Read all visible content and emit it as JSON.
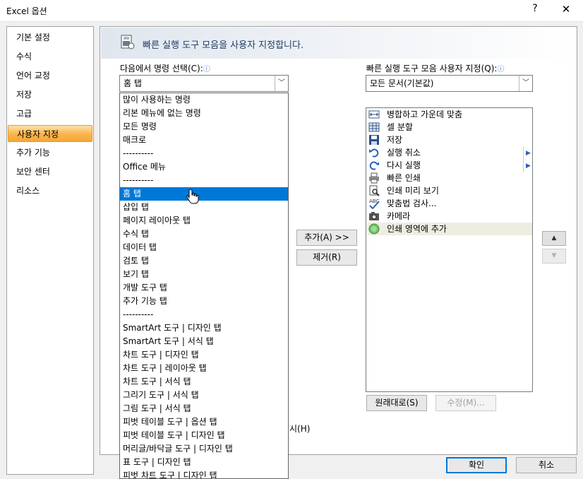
{
  "window": {
    "title": "Excel 옵션",
    "help": "?",
    "close": "✕"
  },
  "nav": {
    "items": [
      {
        "label": "기본 설정"
      },
      {
        "label": "수식"
      },
      {
        "label": "언어 교정"
      },
      {
        "label": "저장"
      },
      {
        "label": "고급"
      },
      {
        "label": "사용자 지정",
        "selected": true
      },
      {
        "label": "추가 기능"
      },
      {
        "label": "보안 센터"
      },
      {
        "label": "리소스"
      }
    ]
  },
  "header": {
    "text": "빠른 실행 도구 모음을 사용자 지정합니다."
  },
  "left": {
    "label": "다음에서 명령 선택(C):",
    "info": "ⓘ",
    "combo_value": "홈 탭",
    "dropdown_items": [
      "많이 사용하는 명령",
      "리본 메뉴에 없는 명령",
      "모든 명령",
      "매크로",
      "----------",
      "Office 메뉴",
      "----------",
      "홈 탭",
      "삽입 탭",
      "페이지 레이아웃 탭",
      "수식 탭",
      "데이터 탭",
      "검토 탭",
      "보기 탭",
      "개발 도구 탭",
      "추가 기능 탭",
      "----------",
      "SmartArt 도구 | 디자인 탭",
      "SmartArt 도구 | 서식 탭",
      "차트 도구 | 디자인 탭",
      "차트 도구 | 레이아웃 탭",
      "차트 도구 | 서식 탭",
      "그리기 도구 | 서식 탭",
      "그림 도구 | 서식 탭",
      "피벗 테이블 도구 | 옵션 탭",
      "피벗 테이블 도구 | 디자인 탭",
      "머리글/바닥글 도구 | 디자인 탭",
      "표 도구 | 디자인 탭",
      "피벗 차트 도구 | 디자인 탭"
    ],
    "selected_index": 7,
    "hidden_text": "시(H)"
  },
  "right": {
    "label": "빠른 실행 도구 모음 사용자 지정(Q):",
    "info": "ⓘ",
    "combo_value": "모든 문서(기본값)",
    "items": [
      {
        "label": "병합하고 가운데 맞춤",
        "icon": "merge-center-icon"
      },
      {
        "label": "셀 분할",
        "icon": "split-cells-icon"
      },
      {
        "label": "저장",
        "icon": "save-icon"
      },
      {
        "label": "실행 취소",
        "icon": "undo-icon",
        "submenu": true
      },
      {
        "label": "다시 실행",
        "icon": "redo-icon",
        "submenu": true
      },
      {
        "label": "빠른 인쇄",
        "icon": "quick-print-icon"
      },
      {
        "label": "인쇄 미리 보기",
        "icon": "print-preview-icon"
      },
      {
        "label": "맞춤법 검사...",
        "icon": "spelling-icon"
      },
      {
        "label": "카메라",
        "icon": "camera-icon"
      },
      {
        "label": "인쇄 영역에 추가",
        "icon": "add-print-area-icon",
        "selected": true
      }
    ],
    "submenu_glyph": "▶"
  },
  "buttons": {
    "add": "추가(A) >>",
    "remove": "제거(R)",
    "reset": "원래대로(S)",
    "modify": "수정(M)...",
    "move_up": "▲",
    "move_down": "▼",
    "ok": "확인",
    "cancel": "취소"
  },
  "colors": {
    "selection_blue": "#0078d7",
    "nav_selected": "#f9b44c",
    "qat_selected": "#efede2"
  }
}
